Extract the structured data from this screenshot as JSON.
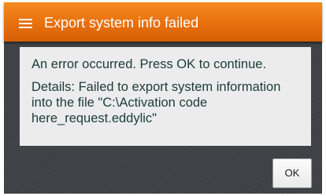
{
  "dialog": {
    "title": "Export system info failed",
    "menu_icon": "hamburger-menu-icon",
    "message": "An error occurred. Press OK to continue.",
    "details": "Details: Failed to export system information\ninto the file \"C:\\Activation code\nhere_request.eddylic\"",
    "ok_label": "OK"
  },
  "colors": {
    "titlebar_accent": "#ee7614",
    "text": "#1b3b3a",
    "panel_background": "#ececec",
    "dialog_background": "#3e4045"
  }
}
